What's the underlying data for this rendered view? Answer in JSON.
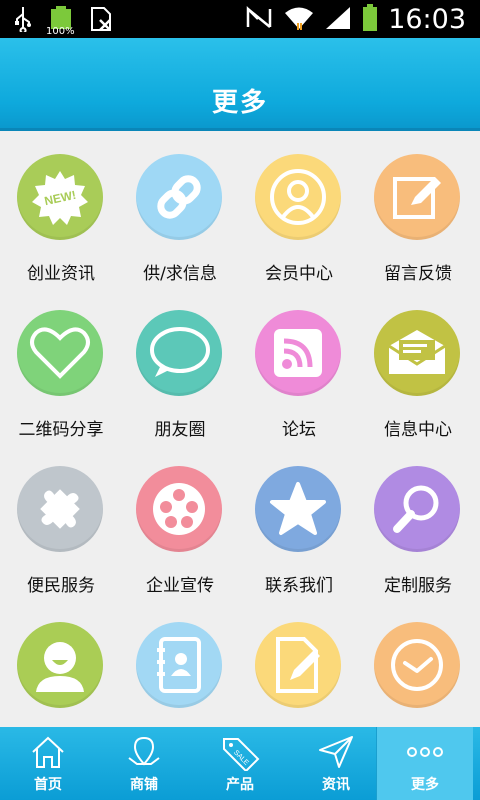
{
  "status_bar": {
    "time": "16:03",
    "battery_left_text": "100%",
    "icons": [
      "usb-icon",
      "battery-full-icon",
      "sim-blocked-icon",
      "mute-icon",
      "wifi-icon",
      "signal-icon",
      "battery-icon"
    ]
  },
  "header": {
    "title": "更多"
  },
  "grid": {
    "items": [
      {
        "label": "创业资讯",
        "icon": "new-badge-icon",
        "color": "#a9cc58"
      },
      {
        "label": "供/求信息",
        "icon": "chain-link-icon",
        "color": "#9fd8f5"
      },
      {
        "label": "会员中心",
        "icon": "person-icon",
        "color": "#fbd97a"
      },
      {
        "label": "留言反馈",
        "icon": "edit-icon",
        "color": "#f8bd7c"
      },
      {
        "label": "二维码分享",
        "icon": "heart-icon",
        "color": "#7fd37a"
      },
      {
        "label": "朋友圈",
        "icon": "chat-bubble-icon",
        "color": "#5cc8b8"
      },
      {
        "label": "论坛",
        "icon": "rss-icon",
        "color": "#ef8bd8"
      },
      {
        "label": "信息中心",
        "icon": "envelope-icon",
        "color": "#c1c244"
      },
      {
        "label": "便民服务",
        "icon": "puzzle-icon",
        "color": "#bfc6cc"
      },
      {
        "label": "企业宣传",
        "icon": "film-reel-icon",
        "color": "#f28d9b"
      },
      {
        "label": "联系我们",
        "icon": "star-icon",
        "color": "#7fa9df"
      },
      {
        "label": "定制服务",
        "icon": "magnifier-icon",
        "color": "#b08be3"
      },
      {
        "label": "",
        "icon": "user-face-icon",
        "color": "#aacd55"
      },
      {
        "label": "",
        "icon": "address-book-icon",
        "color": "#a2d8f4"
      },
      {
        "label": "",
        "icon": "document-edit-icon",
        "color": "#fbd97a"
      },
      {
        "label": "",
        "icon": "clock-icon",
        "color": "#f8bd7c"
      }
    ]
  },
  "tabbar": {
    "tabs": [
      {
        "label": "首页",
        "icon": "home-icon"
      },
      {
        "label": "商铺",
        "icon": "map-pin-icon"
      },
      {
        "label": "产品",
        "icon": "sale-tag-icon"
      },
      {
        "label": "资讯",
        "icon": "paper-plane-icon"
      },
      {
        "label": "更多",
        "icon": "more-dots-icon"
      }
    ],
    "active_index": 4
  }
}
